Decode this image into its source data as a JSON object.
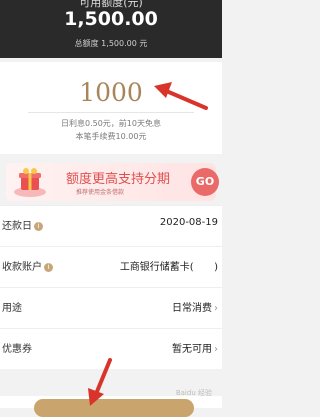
{
  "header": {
    "top_cut_text": "可用额度(元)",
    "available_amount": "1,500.00",
    "total_limit": "总额度 1,500.00 元"
  },
  "amount": {
    "value": "1000",
    "interest_line": "日利息0.50元，前10天免息",
    "fee_line": "本笔手续费10.00元"
  },
  "promo": {
    "title": "额度更高支持分期",
    "subtitle": "推荐使用金条借款",
    "go_label": "GO"
  },
  "form": {
    "rows": [
      {
        "label": "还款日",
        "value": "2020-08-19",
        "has_info": true
      },
      {
        "label": "收款账户",
        "value": "工商银行储蓄卡(",
        "has_info": true,
        "suffix": ")"
      },
      {
        "label": "用途",
        "value": "日常消费",
        "chevron": true
      },
      {
        "label": "优惠券",
        "value": "暂无可用",
        "chevron": true
      }
    ]
  },
  "watermark": "Baidu 经验",
  "colors": {
    "header_bg": "#2a2a2a",
    "amount_gold": "#a8865a",
    "promo_red": "#e05050",
    "arrow_red": "#d9342b"
  }
}
